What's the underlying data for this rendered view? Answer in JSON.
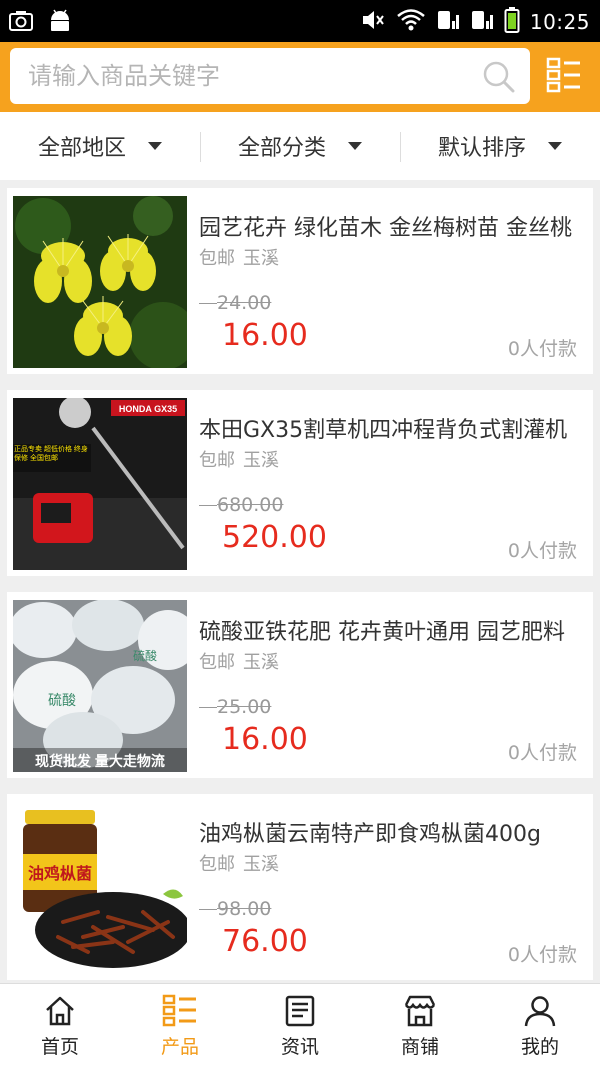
{
  "status_bar": {
    "time": "10:25"
  },
  "search": {
    "placeholder": "请输入商品关键字"
  },
  "filters": [
    {
      "label": "全部地区"
    },
    {
      "label": "全部分类"
    },
    {
      "label": "默认排序"
    }
  ],
  "products": [
    {
      "title": "园艺花卉 绿化苗木 金丝梅树苗 金丝桃",
      "shipping": "包邮",
      "location": "玉溪",
      "original_price": "24.00",
      "price": "16.00",
      "paid": "0人付款"
    },
    {
      "title": "本田GX35割草机四冲程背负式割灌机",
      "shipping": "包邮",
      "location": "玉溪",
      "original_price": "680.00",
      "price": "520.00",
      "paid": "0人付款"
    },
    {
      "title": "硫酸亚铁花肥 花卉黄叶通用 园艺肥料",
      "shipping": "包邮",
      "location": "玉溪",
      "original_price": "25.00",
      "price": "16.00",
      "paid": "0人付款"
    },
    {
      "title": "油鸡枞菌云南特产即食鸡枞菌400g",
      "shipping": "包邮",
      "location": "玉溪",
      "original_price": "98.00",
      "price": "76.00",
      "paid": "0人付款"
    }
  ],
  "image_text": {
    "p2_brand": "HONDA GX35",
    "p2_banner": "正品专卖 超低价格 终身保修 全国包邮",
    "p3_banner": "现货批发 量大走物流",
    "p4_label": "油鸡枞菌"
  },
  "tabs": [
    {
      "label": "首页",
      "icon": "home-icon"
    },
    {
      "label": "产品",
      "icon": "products-icon",
      "active": true
    },
    {
      "label": "资讯",
      "icon": "news-icon"
    },
    {
      "label": "商铺",
      "icon": "shop-icon"
    },
    {
      "label": "我的",
      "icon": "user-icon"
    }
  ],
  "colors": {
    "accent": "#f6a21e",
    "price": "#e62b1e",
    "active_tab": "#f29a17"
  }
}
